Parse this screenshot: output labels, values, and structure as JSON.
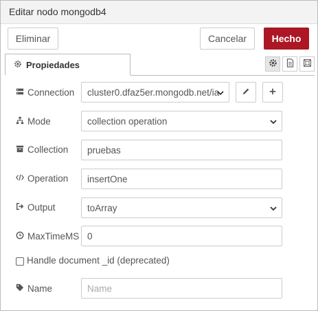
{
  "window": {
    "title": "Editar nodo mongodb4"
  },
  "toolbar": {
    "delete_label": "Eliminar",
    "cancel_label": "Cancelar",
    "done_label": "Hecho",
    "done_color": "#ad1625"
  },
  "tabs": {
    "properties_label": "Propiedades",
    "icons": [
      "gear-icon",
      "document-icon",
      "frame-icon"
    ]
  },
  "form": {
    "connection": {
      "label": "Connection",
      "value": "cluster0.dfaz5er.mongodb.net/ia"
    },
    "mode": {
      "label": "Mode",
      "value": "collection operation"
    },
    "collection": {
      "label": "Collection",
      "value": "pruebas"
    },
    "operation": {
      "label": "Operation",
      "value": "insertOne"
    },
    "output": {
      "label": "Output",
      "value": "toArray"
    },
    "maxtime": {
      "label": "MaxTimeMS",
      "value": "0"
    },
    "handle_id": {
      "label": "Handle document _id (deprecated)",
      "checked": false
    },
    "name": {
      "label": "Name",
      "value": "",
      "placeholder": "Name"
    }
  }
}
